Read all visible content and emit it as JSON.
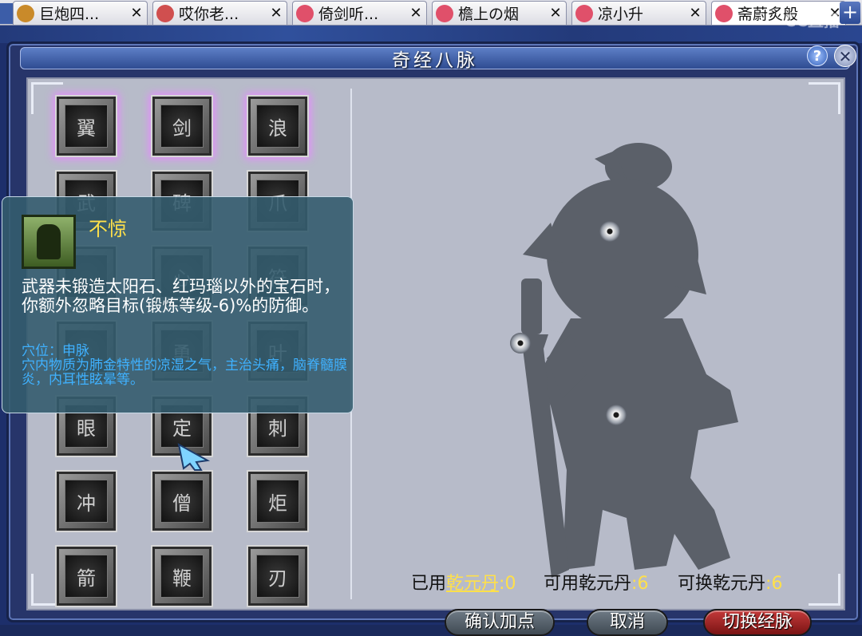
{
  "tabs": [
    {
      "label": "巨炮四...",
      "color": "#c98a2a"
    },
    {
      "label": "哎你老...",
      "color": "#d04f4f"
    },
    {
      "label": "倚剑听...",
      "color": "#e0506a"
    },
    {
      "label": "檐上の烟",
      "color": "#e0506a"
    },
    {
      "label": "凉小升",
      "color": "#e0506a"
    },
    {
      "label": "斋蔚炙般",
      "color": "#e0506a"
    }
  ],
  "watermark": "CC直播",
  "window": {
    "title": "奇经八脉",
    "help": "?",
    "close": "✕"
  },
  "skills": [
    {
      "icon": "wing-icon",
      "glyph": "翼",
      "glow": true
    },
    {
      "icon": "sword-slash-icon",
      "glyph": "剑",
      "glow": true
    },
    {
      "icon": "wave-icon",
      "glyph": "浪",
      "glow": true
    },
    {
      "icon": "warrior-icon",
      "glyph": "武",
      "glow": false
    },
    {
      "icon": "tombstone-icon",
      "glyph": "碑",
      "glow": false
    },
    {
      "icon": "claws-icon",
      "glyph": "爪",
      "glow": false
    },
    {
      "icon": "hidden-slot-1",
      "glyph": "",
      "glow": false
    },
    {
      "icon": "heart-icon",
      "glyph": "心",
      "glow": false
    },
    {
      "icon": "rune-icon",
      "glyph": "符",
      "glow": false
    },
    {
      "icon": "hidden-slot-2",
      "glyph": "",
      "glow": false
    },
    {
      "icon": "brave-icon",
      "glyph": "勇",
      "glow": false
    },
    {
      "icon": "leaf-icon",
      "glyph": "叶",
      "glow": false
    },
    {
      "icon": "eye-icon",
      "glyph": "眼",
      "glow": false
    },
    {
      "icon": "meditate-icon",
      "glyph": "定",
      "glow": false
    },
    {
      "icon": "spikes-icon",
      "glyph": "刺",
      "glow": false
    },
    {
      "icon": "dash-icon",
      "glyph": "冲",
      "glow": false
    },
    {
      "icon": "monk-icon",
      "glyph": "僧",
      "glow": false
    },
    {
      "icon": "torch-icon",
      "glyph": "炬",
      "glow": false
    },
    {
      "icon": "arrows-icon",
      "glyph": "箭",
      "glow": false
    },
    {
      "icon": "whip-icon",
      "glyph": "鞭",
      "glow": false
    },
    {
      "icon": "blades-icon",
      "glyph": "刃",
      "glow": false
    }
  ],
  "tooltip": {
    "name": "不惊",
    "description": "武器未锻造太阳石、红玛瑙以外的宝石时，你额外忽略目标(锻炼等级-6)%的防御。",
    "acupoint": "穴位：申脉",
    "detail": "穴内物质为肺金特性的凉湿之气，主治头痛，脑脊髓膜炎，内耳性眩晕等。"
  },
  "stats": {
    "used_label": "已用",
    "used_item": "乾元丹",
    "used_value": "0",
    "available_label": "可用乾元丹",
    "available_value": "6",
    "exchange_label": "可换乾元丹",
    "exchange_value": "6"
  },
  "buttons": {
    "confirm": "确认加点",
    "cancel": "取消",
    "switch": "切换经脉"
  }
}
